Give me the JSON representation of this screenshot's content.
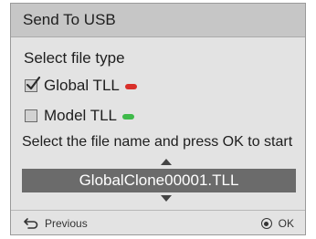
{
  "dialog": {
    "title": "Send To USB",
    "section_label": "Select file type",
    "options": [
      {
        "label": "Global TLL",
        "checked": true,
        "indicator_color": "#d9302a"
      },
      {
        "label": "Model TLL",
        "checked": false,
        "indicator_color": "#3fba4a"
      }
    ],
    "instruction": "Select the file name and press OK to start",
    "file_name": "GlobalClone00001.TLL",
    "footer": {
      "previous_label": "Previous",
      "ok_label": "OK"
    }
  },
  "colors": {
    "title_bar": "#c6c6c6",
    "panel": "#e3e3e3",
    "selector": "#6b6b6b"
  }
}
